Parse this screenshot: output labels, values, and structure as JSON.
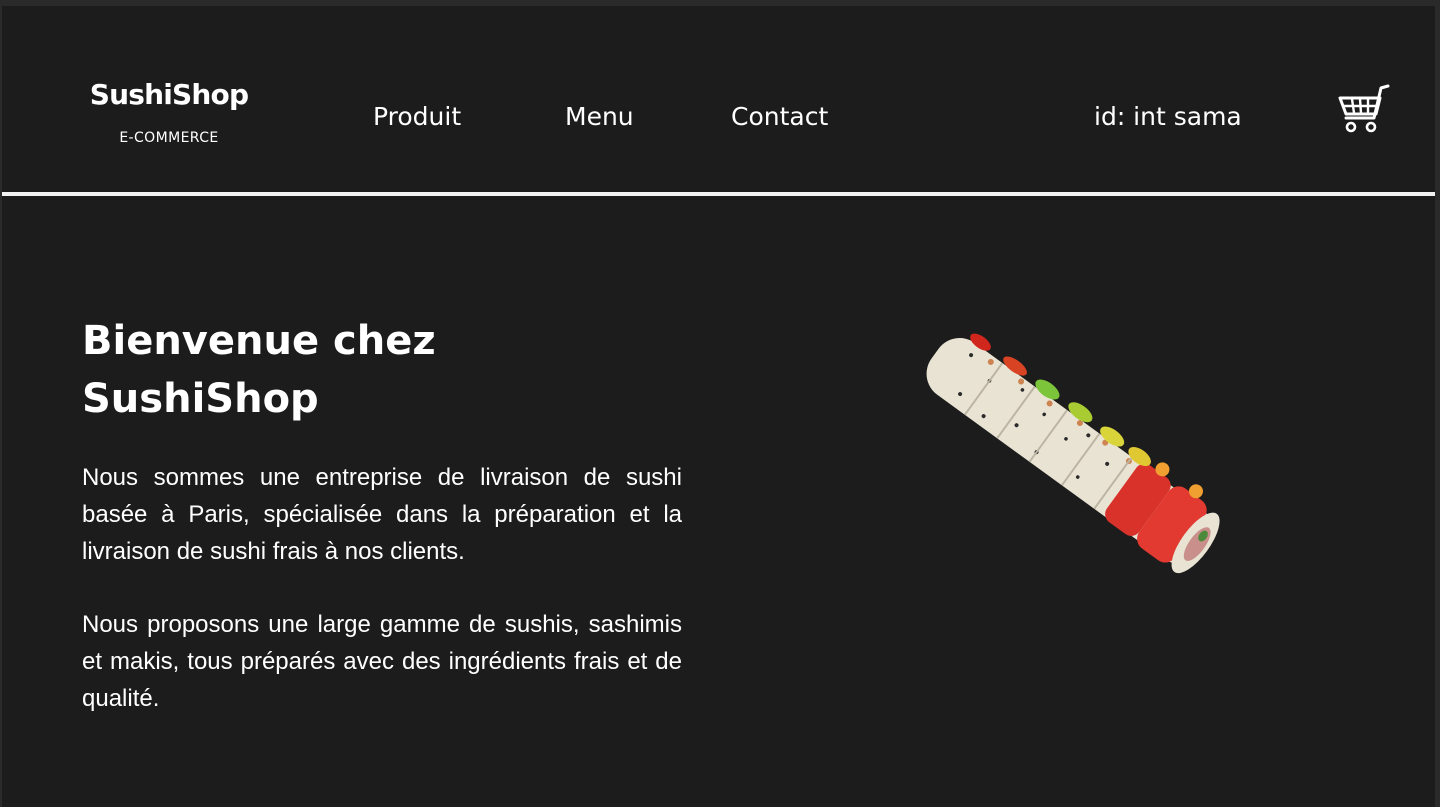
{
  "header": {
    "brand_name": "SushiShop",
    "brand_sub": "E-COMMERCE",
    "nav": {
      "produit": "Produit",
      "menu": "Menu",
      "contact": "Contact"
    },
    "user_id": "id: int sama",
    "cart_icon": "shopping-cart-icon"
  },
  "hero": {
    "title_line1": "Bienvenue chez",
    "title_line2": "SushiShop",
    "paragraph1": "Nous sommes une entreprise de livraison de sushi basée à Paris, spécialisée dans la préparation et la livraison de sushi frais à nos clients.",
    "paragraph2": "Nous proposons une large gamme de sushis, sashimis et makis, tous préparés avec des ingrédients frais et de qualité.",
    "image": "sushi-roll-image"
  },
  "colors": {
    "background": "#1c1c1c",
    "text": "#ffffff",
    "divider": "#f2f2f2"
  }
}
